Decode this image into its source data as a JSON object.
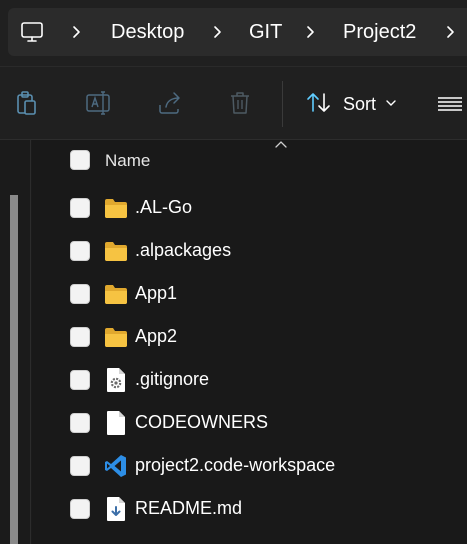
{
  "breadcrumb": {
    "root_icon": "computer-icon",
    "items": [
      "Desktop",
      "GIT",
      "Project2"
    ]
  },
  "toolbar": {
    "buttons": [
      {
        "name": "paste",
        "icon": "paste-icon"
      },
      {
        "name": "rename",
        "icon": "rename-icon"
      },
      {
        "name": "share",
        "icon": "share-icon"
      },
      {
        "name": "delete",
        "icon": "delete-icon"
      }
    ],
    "sort_label": "Sort",
    "view_icon": "view-menu-icon"
  },
  "file_list": {
    "column_name": "Name",
    "items": [
      {
        "name": ".AL-Go",
        "type": "folder"
      },
      {
        "name": ".alpackages",
        "type": "folder"
      },
      {
        "name": "App1",
        "type": "folder"
      },
      {
        "name": "App2",
        "type": "folder"
      },
      {
        "name": ".gitignore",
        "type": "settings-file"
      },
      {
        "name": "CODEOWNERS",
        "type": "file"
      },
      {
        "name": "project2.code-workspace",
        "type": "vscode-file"
      },
      {
        "name": "README.md",
        "type": "markdown-file"
      }
    ]
  },
  "colors": {
    "folder": "#f6c342",
    "folder_dark": "#e0a82e",
    "vscode": "#2d8ee6",
    "accent": "#60cdff",
    "background": "#191919"
  }
}
